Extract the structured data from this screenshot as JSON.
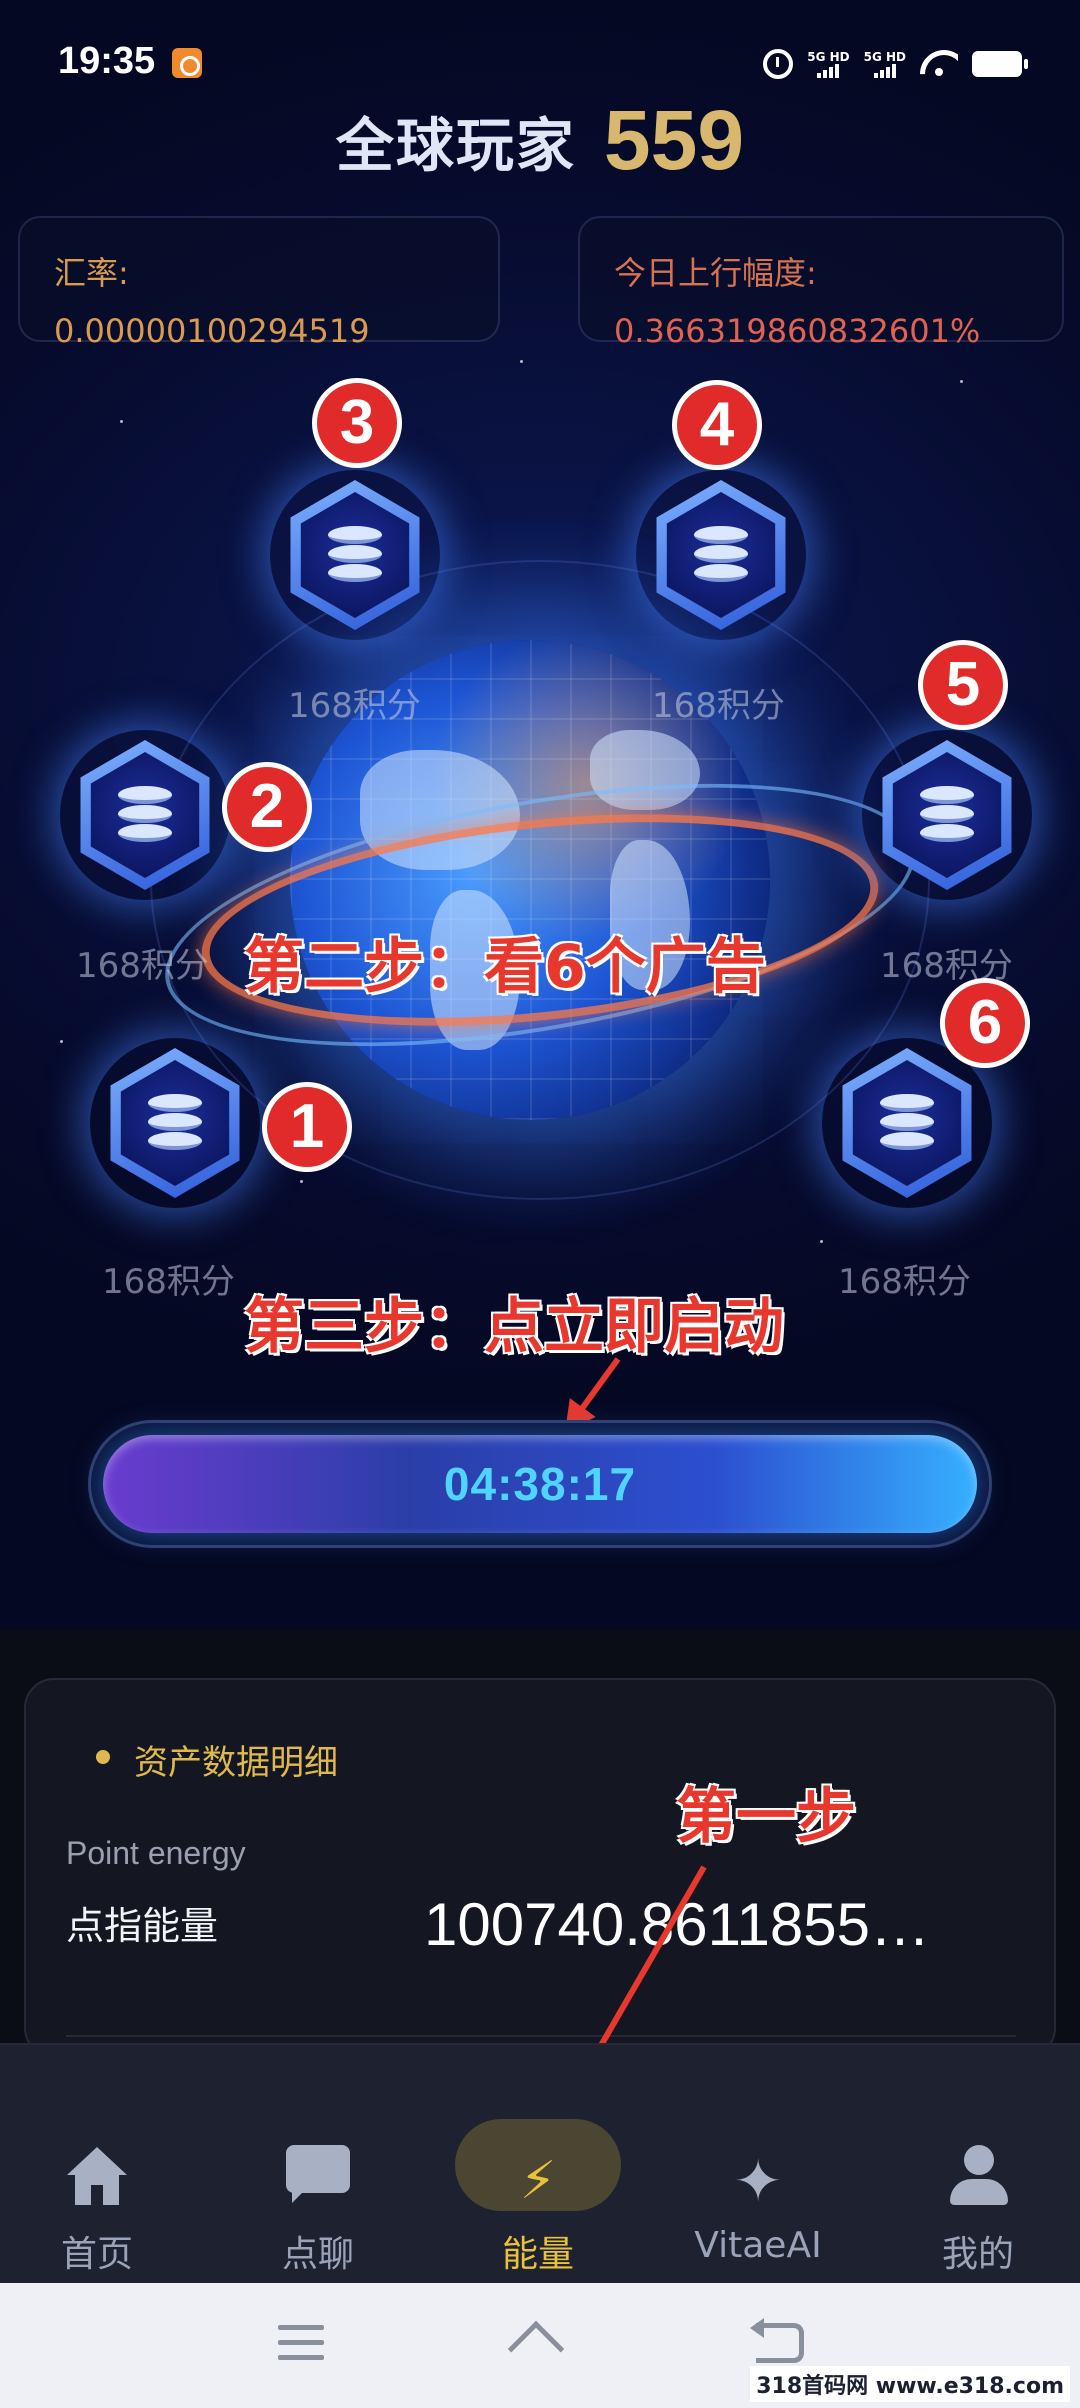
{
  "status_bar": {
    "time": "19:35",
    "net1": "5G HD",
    "net2": "5G HD"
  },
  "header": {
    "label": "全球玩家",
    "count": "559"
  },
  "rate_card": {
    "label": "汇率:",
    "value": "0.00000100294519"
  },
  "rise_card": {
    "label": "今日上行幅度:",
    "value": "0.366319860832601%"
  },
  "nodes": [
    {
      "points": "168积分",
      "step": "1"
    },
    {
      "points": "168积分",
      "step": "2"
    },
    {
      "points": "168积分",
      "step": "3"
    },
    {
      "points": "168积分",
      "step": "4"
    },
    {
      "points": "168积分",
      "step": "5"
    },
    {
      "points": "168积分",
      "step": "6"
    }
  ],
  "annotations": {
    "step1": "第一步",
    "step2": "第二步：看6个广告",
    "step3": "第三步：点立即启动"
  },
  "timer": {
    "value": "04:38:17"
  },
  "assets": {
    "title": "资产数据明细",
    "sub_label": "Point energy",
    "name": "点指能量",
    "value": "100740.8611855…"
  },
  "tabs": [
    {
      "label": "首页",
      "icon": "home-icon",
      "active": false
    },
    {
      "label": "点聊",
      "icon": "chat-icon",
      "active": false
    },
    {
      "label": "能量",
      "icon": "bolt-icon",
      "active": true
    },
    {
      "label": "VitaeAI",
      "icon": "sparkle-icon",
      "active": false
    },
    {
      "label": "我的",
      "icon": "user-icon",
      "active": false
    }
  ],
  "watermark": "318首码网 www.e318.com",
  "colors": {
    "accent_gold": "#d8b76e",
    "active_tab": "#e8c23a",
    "annotation_red": "#e8382d",
    "timer_text": "#4fd4ff"
  }
}
